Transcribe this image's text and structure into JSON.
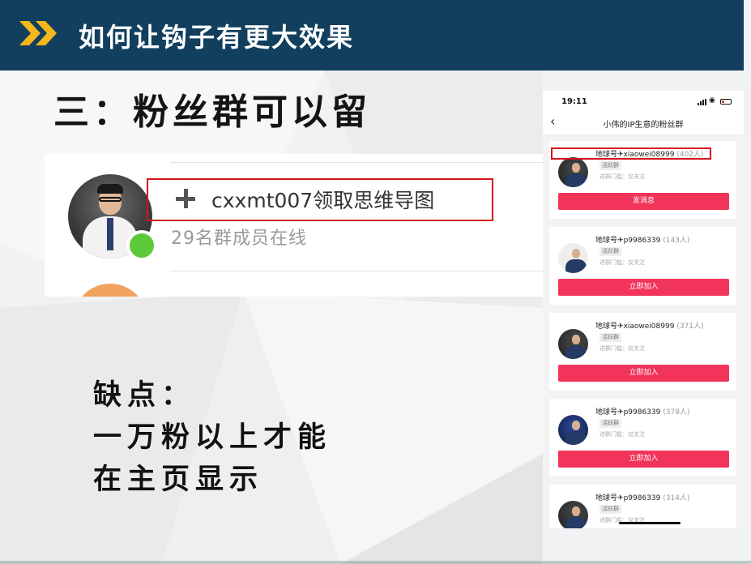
{
  "header": {
    "title": "如何让钩子有更大效果",
    "icon": "double-chevron-right-icon"
  },
  "heading": "三：粉丝群可以留",
  "group_card": {
    "join_text": "cxxmt007领取思维导图",
    "online_text": "29名群成员在线",
    "plus_icon": "plus-icon"
  },
  "cons": {
    "line1": "缺点：",
    "line2": "一万粉以上才能",
    "line3": "在主页显示"
  },
  "phone": {
    "status_time": "19:11",
    "nav_title": "小伟的IP生意的粉丝群",
    "groups": [
      {
        "name": "地球号",
        "account": "xiaowei08999",
        "count": "(402人)",
        "badge": "活跃群",
        "meta": "进群门槛：仅关注",
        "button": "发消息"
      },
      {
        "name": "地球号",
        "account": "p9986339",
        "count": "(143人)",
        "badge": "活跃群",
        "meta": "进群门槛：仅关注",
        "button": "立即加入"
      },
      {
        "name": "地球号",
        "account": "xiaowei08999",
        "count": "(371人)",
        "badge": "活跃群",
        "meta": "进群门槛：仅关注",
        "button": "立即加入"
      },
      {
        "name": "地球号",
        "account": "p9986339",
        "count": "(378人)",
        "badge": "活跃群",
        "meta": "进群门槛：仅关注",
        "button": "立即加入"
      },
      {
        "name": "地球号",
        "account": "p9986339",
        "count": "(314人)",
        "badge": "活跃群",
        "meta": "进群门槛：仅关注",
        "button": ""
      }
    ]
  },
  "colors": {
    "header_bg": "#123f5e",
    "accent_yellow": "#f4b61b",
    "highlight_red": "#d3141b",
    "button_pink": "#f2345a",
    "online_green": "#5cc83a"
  }
}
